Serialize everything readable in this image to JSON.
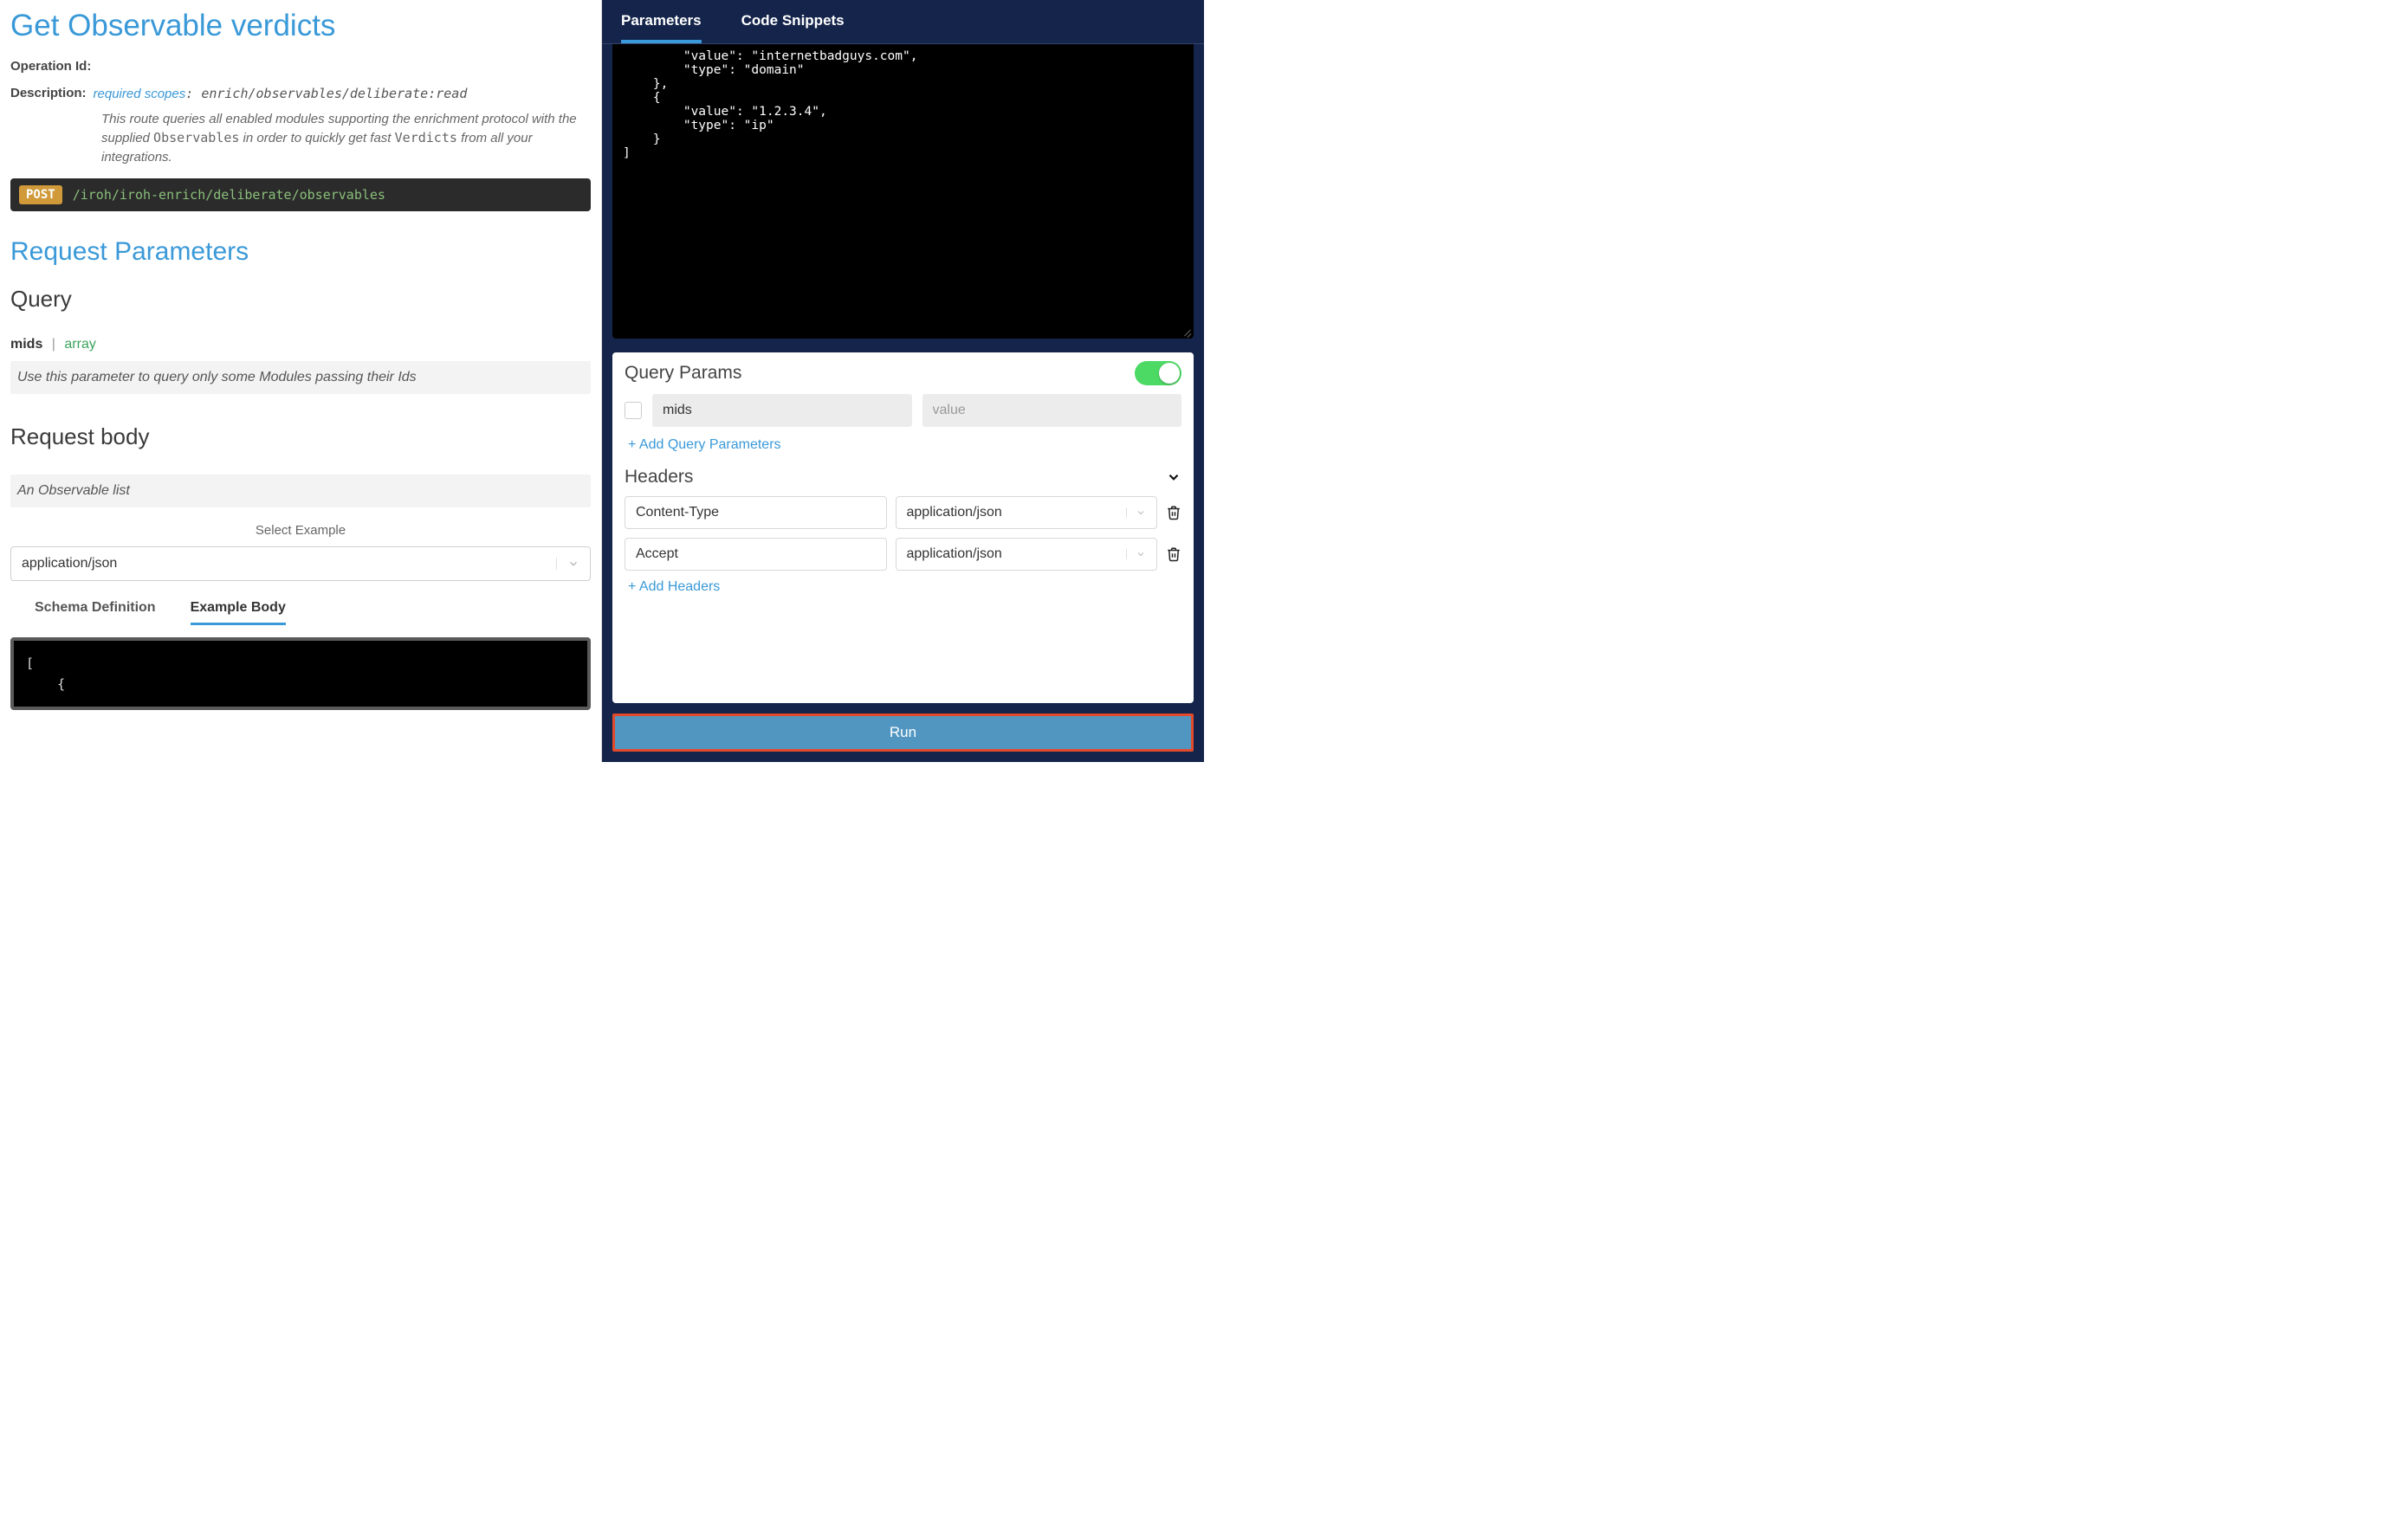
{
  "left": {
    "title": "Get Observable verdicts",
    "operation_id_label": "Operation Id:",
    "description_label": "Description:",
    "scopes_prefix": "required scopes",
    "scopes_value": "enrich/observables/deliberate:read",
    "description_line1": "This route queries all enabled modules supporting the enrichment protocol with the supplied ",
    "description_code1": "Observables",
    "description_line2": " in order to quickly get fast ",
    "description_code2": "Verdicts",
    "description_line3": " from all your integrations.",
    "method": "POST",
    "path": "/iroh/iroh-enrich/deliberate/observables",
    "h2_request_parameters": "Request Parameters",
    "h3_query": "Query",
    "param_name": "mids",
    "param_type": "array",
    "param_desc": "Use this parameter to query only some Modules passing their Ids",
    "h3_request_body": "Request body",
    "body_desc": "An Observable list",
    "select_label": "Select Example",
    "select_value": "application/json",
    "tabs": {
      "schema": "Schema Definition",
      "example": "Example Body"
    },
    "example_body_preview": "[\n    {"
  },
  "right": {
    "tabs": {
      "parameters": "Parameters",
      "snippets": "Code Snippets"
    },
    "editor_text": "        \"value\": \"internetbadguys.com\",\n        \"type\": \"domain\"\n    },\n    {\n        \"value\": \"1.2.3.4\",\n        \"type\": \"ip\"\n    }\n]",
    "query_params": {
      "title": "Query Params",
      "rows": [
        {
          "name": "mids",
          "value": "",
          "value_placeholder": "value"
        }
      ],
      "add_link": "+ Add Query Parameters"
    },
    "headers": {
      "title": "Headers",
      "rows": [
        {
          "name": "Content-Type",
          "value": "application/json"
        },
        {
          "name": "Accept",
          "value": "application/json"
        }
      ],
      "add_link": "+ Add Headers"
    },
    "run_label": "Run"
  }
}
